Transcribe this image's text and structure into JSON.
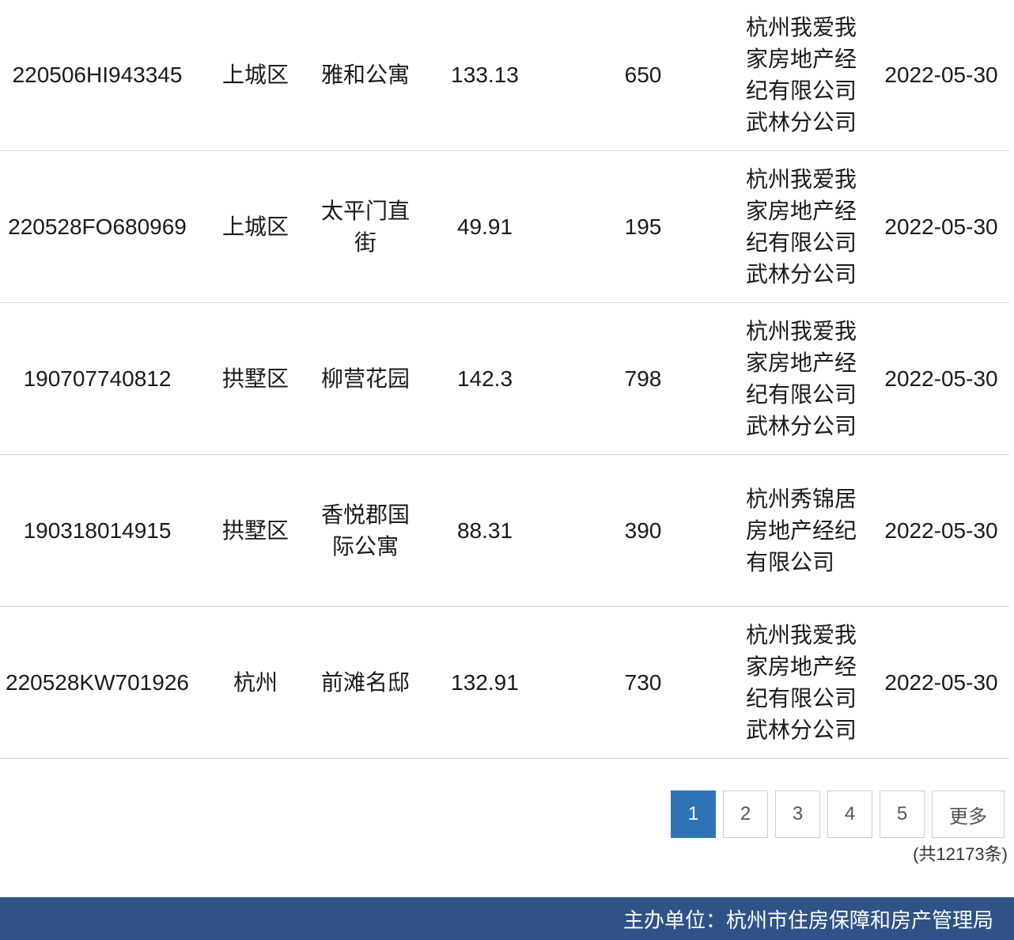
{
  "rows": [
    {
      "id": "220506HI943345",
      "district": "上城区",
      "community": "雅和公寓",
      "area": "133.13",
      "price": "650",
      "agency": "杭州我爱我家房地产经纪有限公司武林分公司",
      "date": "2022-05-30"
    },
    {
      "id": "220528FO680969",
      "district": "上城区",
      "community": "太平门直街",
      "area": "49.91",
      "price": "195",
      "agency": "杭州我爱我家房地产经纪有限公司武林分公司",
      "date": "2022-05-30"
    },
    {
      "id": "190707740812",
      "district": "拱墅区",
      "community": "柳营花园",
      "area": "142.3",
      "price": "798",
      "agency": "杭州我爱我家房地产经纪有限公司武林分公司",
      "date": "2022-05-30"
    },
    {
      "id": "190318014915",
      "district": "拱墅区",
      "community": "香悦郡国际公寓",
      "area": "88.31",
      "price": "390",
      "agency": "杭州秀锦居房地产经纪有限公司",
      "date": "2022-05-30"
    },
    {
      "id": "220528KW701926",
      "district": "杭州",
      "community": "前滩名邸",
      "area": "132.91",
      "price": "730",
      "agency": "杭州我爱我家房地产经纪有限公司武林分公司",
      "date": "2022-05-30"
    }
  ],
  "pagination": {
    "pages": [
      "1",
      "2",
      "3",
      "4",
      "5"
    ],
    "current": "1",
    "more_label": "更多",
    "total_text": "(共12173条)"
  },
  "footer": {
    "text": "主办单位：杭州市住房保障和房产管理局"
  },
  "colors": {
    "active_page": "#2e74b5",
    "footer_bg": "#2f5387"
  }
}
